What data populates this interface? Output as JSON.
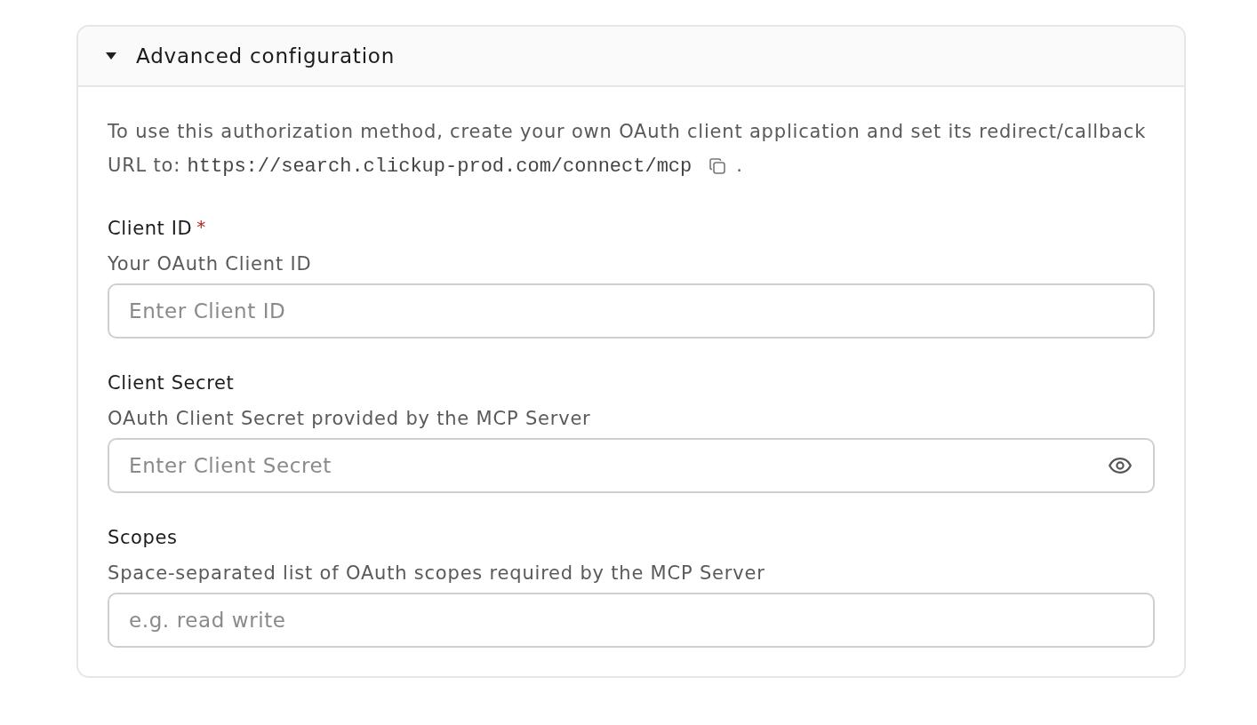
{
  "section": {
    "title": "Advanced configuration",
    "expanded": true,
    "intro": {
      "text": "To use this authorization method, create your own OAuth client application and set its redirect/callback URL to:",
      "url": "https://search.clickup-prod.com/connect/mcp",
      "suffix": "."
    },
    "fields": [
      {
        "kind": "text",
        "label": "Client ID",
        "required_mark": "*",
        "description": "Your OAuth Client ID",
        "placeholder": "Enter Client ID"
      },
      {
        "kind": "secret",
        "label": "Client Secret",
        "description": "OAuth Client Secret provided by the MCP Server",
        "placeholder": "Enter Client Secret"
      },
      {
        "kind": "text",
        "label": "Scopes",
        "description": "Space-separated list of OAuth scopes required by the MCP Server",
        "placeholder": "e.g. read write"
      }
    ]
  }
}
